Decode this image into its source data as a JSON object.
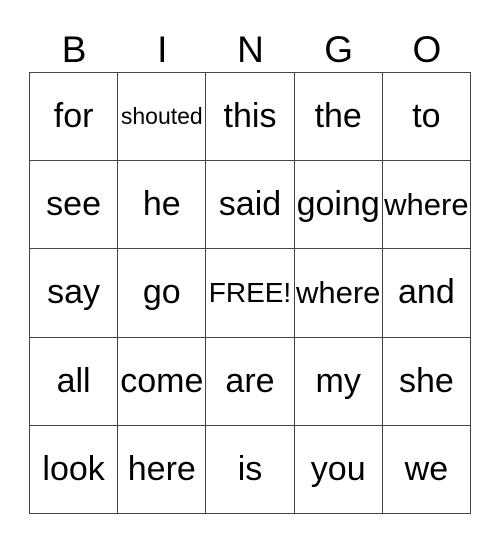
{
  "header": [
    "B",
    "I",
    "N",
    "G",
    "O"
  ],
  "cells": [
    [
      "for",
      "shouted",
      "this",
      "the",
      "to"
    ],
    [
      "see",
      "he",
      "said",
      "going",
      "where"
    ],
    [
      "say",
      "go",
      "FREE!",
      "where",
      "and"
    ],
    [
      "all",
      "come",
      "are",
      "my",
      "she"
    ],
    [
      "look",
      "here",
      "is",
      "you",
      "we"
    ]
  ]
}
